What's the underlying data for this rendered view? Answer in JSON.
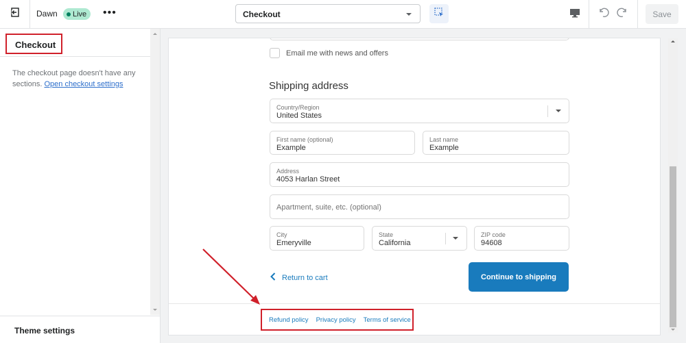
{
  "topbar": {
    "exit_icon": "exit-icon",
    "theme_name": "Dawn",
    "live_badge": "Live",
    "more_icon": "ellipsis-icon",
    "page_select": {
      "selected": "Checkout"
    },
    "inspector_icon": "select-cursor-icon",
    "desktop_icon": "desktop-icon",
    "undo_icon": "undo-icon",
    "redo_icon": "redo-icon",
    "save_label": "Save"
  },
  "sidebar": {
    "title": "Checkout",
    "description": "The checkout page doesn't have any sections.",
    "settings_link": "Open checkout settings",
    "footer": "Theme settings"
  },
  "preview": {
    "newsletter_label": "Email me with news and offers",
    "newsletter_checked": false,
    "section_title": "Shipping address",
    "fields": {
      "country": {
        "label": "Country/Region",
        "value": "United States"
      },
      "first_name": {
        "label": "First name (optional)",
        "value": "Example"
      },
      "last_name": {
        "label": "Last name",
        "value": "Example"
      },
      "address": {
        "label": "Address",
        "value": "4053 Harlan Street"
      },
      "apartment": {
        "placeholder": "Apartment, suite, etc. (optional)"
      },
      "city": {
        "label": "City",
        "value": "Emeryville"
      },
      "state": {
        "label": "State",
        "value": "California"
      },
      "zip": {
        "label": "ZIP code",
        "value": "94608"
      }
    },
    "return_link": "Return to cart",
    "continue_button": "Continue to shipping",
    "policies": [
      "Refund policy",
      "Privacy policy",
      "Terms of service"
    ]
  },
  "colors": {
    "accent": "#197bbd",
    "annotation": "#d0202a",
    "live_badge": "#aee9d1"
  }
}
